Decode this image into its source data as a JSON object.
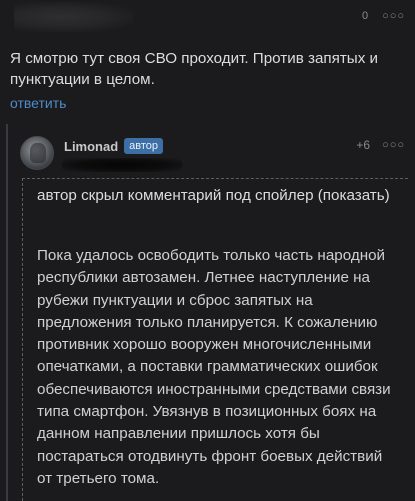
{
  "comment1": {
    "rating": "0",
    "more_icon": "more-dots-icon",
    "text": "Я смотрю тут своя СВО проходит. Против запятых и пунктуации в целом.",
    "reply_label": "ответить"
  },
  "comment2": {
    "username": "Limonad",
    "badge": "автор",
    "rating": "+6",
    "more_icon": "more-dots-icon",
    "spoiler_header": "автор скрыл комментарий под спойлер (показать)",
    "body": "Пока удалось освободить только часть народной республики автозамен. Летнее наступление на рубежи пунктуации и сброс запятых на предложения только планируется. К сожалению противник хорошо вооружен многочисленными опечатками, а поставки грамматических ошибок обеспечиваются иностранными средствами связи типа смартфон. Увязнув в позиционных боях на данном направлении пришлось хотя бы постараться отодвинуть фронт боевых действий от третьего тома."
  },
  "colors": {
    "background": "#1b1b1d",
    "link": "#4f8bc9",
    "badge": "#3d6fa7"
  }
}
